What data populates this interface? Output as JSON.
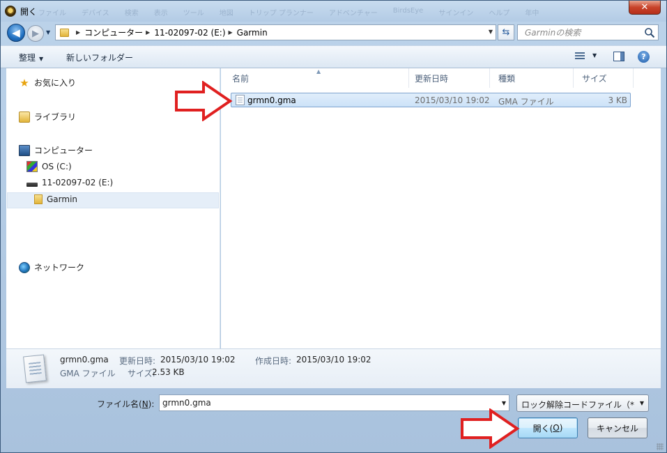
{
  "window": {
    "title": "開く",
    "ghost_menu": [
      "ファイル",
      "デバイス",
      "検索",
      "表示",
      "ツール",
      "地図",
      "トリップ プランナー",
      "アドベンチャー",
      "BirdsEye",
      "サインイン",
      "ヘルプ",
      "年中"
    ],
    "close_label": "✕"
  },
  "address": {
    "crumbs": [
      "コンピューター",
      "11-02097-02 (E:)",
      "Garmin"
    ],
    "search_placeholder": "Garminの検索"
  },
  "toolbar": {
    "organize_label": "整理",
    "new_folder_label": "新しいフォルダー",
    "help_label": "?"
  },
  "nav": {
    "favorites": "お気に入り",
    "libraries": "ライブラリ",
    "computer": "コンピューター",
    "drive_c": "OS (C:)",
    "drive_e": "11-02097-02 (E:)",
    "folder_garmin": "Garmin",
    "network": "ネットワーク"
  },
  "columns": {
    "name": "名前",
    "date": "更新日時",
    "type": "種類",
    "size": "サイズ"
  },
  "files": [
    {
      "name": "grmn0.gma",
      "date": "2015/03/10 19:02",
      "type": "GMA ファイル",
      "size": "3 KB"
    }
  ],
  "details": {
    "name": "grmn0.gma",
    "modified_label": "更新日時:",
    "modified_value": "2015/03/10 19:02",
    "created_label": "作成日時:",
    "created_value": "2015/03/10 19:02",
    "type": "GMA ファイル",
    "size_label": "サイズ:",
    "size_value": "2.53 KB"
  },
  "bottom": {
    "filename_label_pre": "ファイル名(",
    "filename_label_key": "N",
    "filename_label_post": "):",
    "filename_value": "grmn0.gma",
    "filter_value": "ロック解除コードファイル（*",
    "open_label": "開く(",
    "open_key": "O",
    "open_post": ")",
    "cancel_label": "キャンセル"
  },
  "colors": {
    "arrow_red": "#e02020",
    "selection": "#cce2f8",
    "accent": "#3c7fb1"
  }
}
